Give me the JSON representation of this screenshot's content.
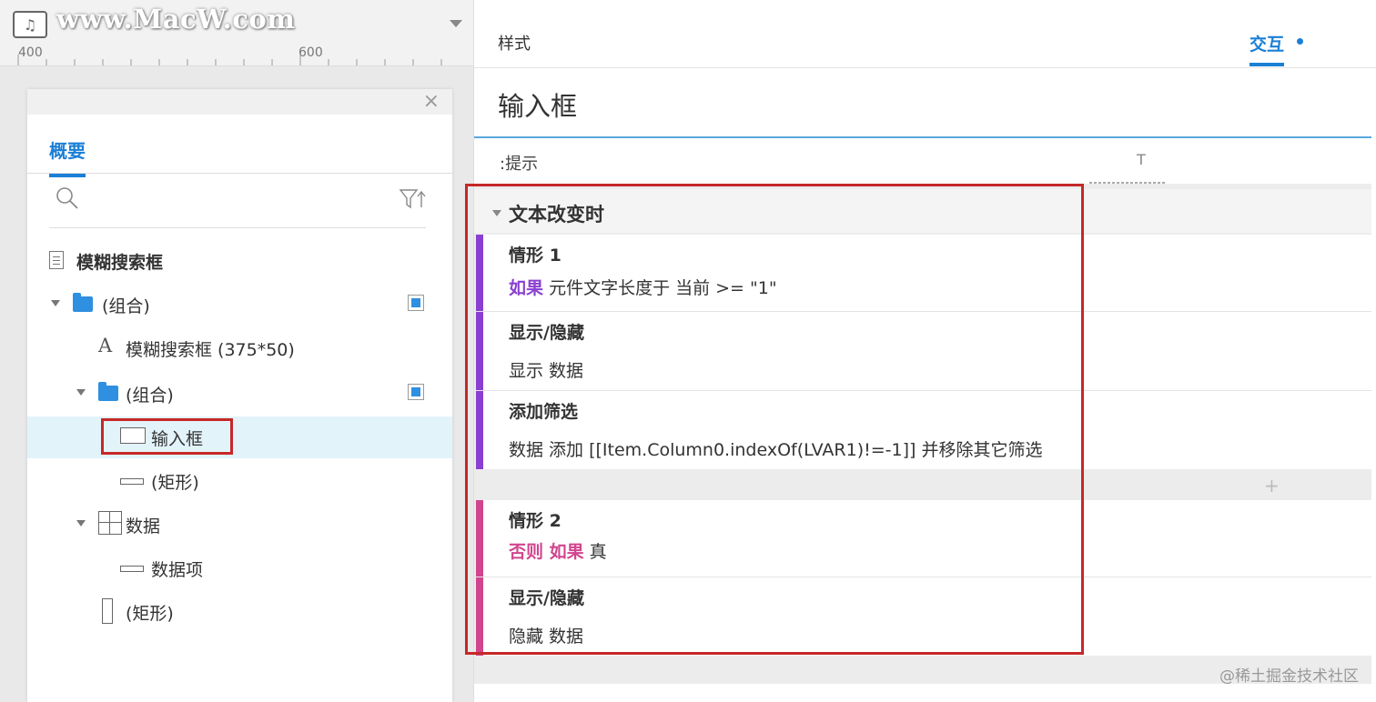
{
  "watermark": {
    "logo": "♫",
    "text": "www.MacW.com"
  },
  "ruler": {
    "labels": [
      "400",
      "600"
    ]
  },
  "outline_panel": {
    "close": "×",
    "tab": "概要",
    "search": {
      "placeholder": ""
    },
    "tree": [
      {
        "label": "模糊搜索框",
        "icon": "page-icon"
      },
      {
        "label": "(组合)",
        "icon": "folder-icon"
      },
      {
        "label": "模糊搜索框 (375*50)",
        "icon": "text-icon",
        "glyph": "A"
      },
      {
        "label": "(组合)",
        "icon": "folder-icon"
      },
      {
        "label": "输入框",
        "icon": "input-icon",
        "selected": true
      },
      {
        "label": "(矩形)",
        "icon": "rectangle-icon"
      },
      {
        "label": "数据",
        "icon": "repeater-icon"
      },
      {
        "label": "数据项",
        "icon": "rectangle-icon"
      },
      {
        "label": "(矩形)",
        "icon": "rectangle-icon"
      }
    ]
  },
  "inspector": {
    "tabs": {
      "style": "样式",
      "interaction": "交互"
    },
    "widget_name": "输入框",
    "hint": {
      "label": ":提示",
      "type_glyph": "T"
    },
    "event": {
      "title": "文本改变时",
      "cases": [
        {
          "name": "情形 1",
          "condition_keyword": "如果",
          "condition_text": "元件文字长度于 当前 >= \"1\"",
          "actions": [
            {
              "title": "显示/隐藏",
              "detail": "显示 数据"
            },
            {
              "title": "添加筛选",
              "detail": "数据 添加 [[Item.Column0.indexOf(LVAR1)!=-1]] 并移除其它筛选"
            }
          ]
        },
        {
          "name": "情形 2",
          "condition_keyword": "否则 如果",
          "condition_text": "真",
          "actions": [
            {
              "title": "显示/隐藏",
              "detail": "隐藏 数据"
            }
          ]
        }
      ],
      "add_case": "+"
    }
  },
  "credit": "@稀土掘金技术社区",
  "colors": {
    "accent": "#1b7fd6",
    "case1_bar": "#8a3fd1",
    "case2_bar": "#d1458e",
    "highlight_box": "#c62828",
    "selected_row": "#e3f3fa"
  }
}
